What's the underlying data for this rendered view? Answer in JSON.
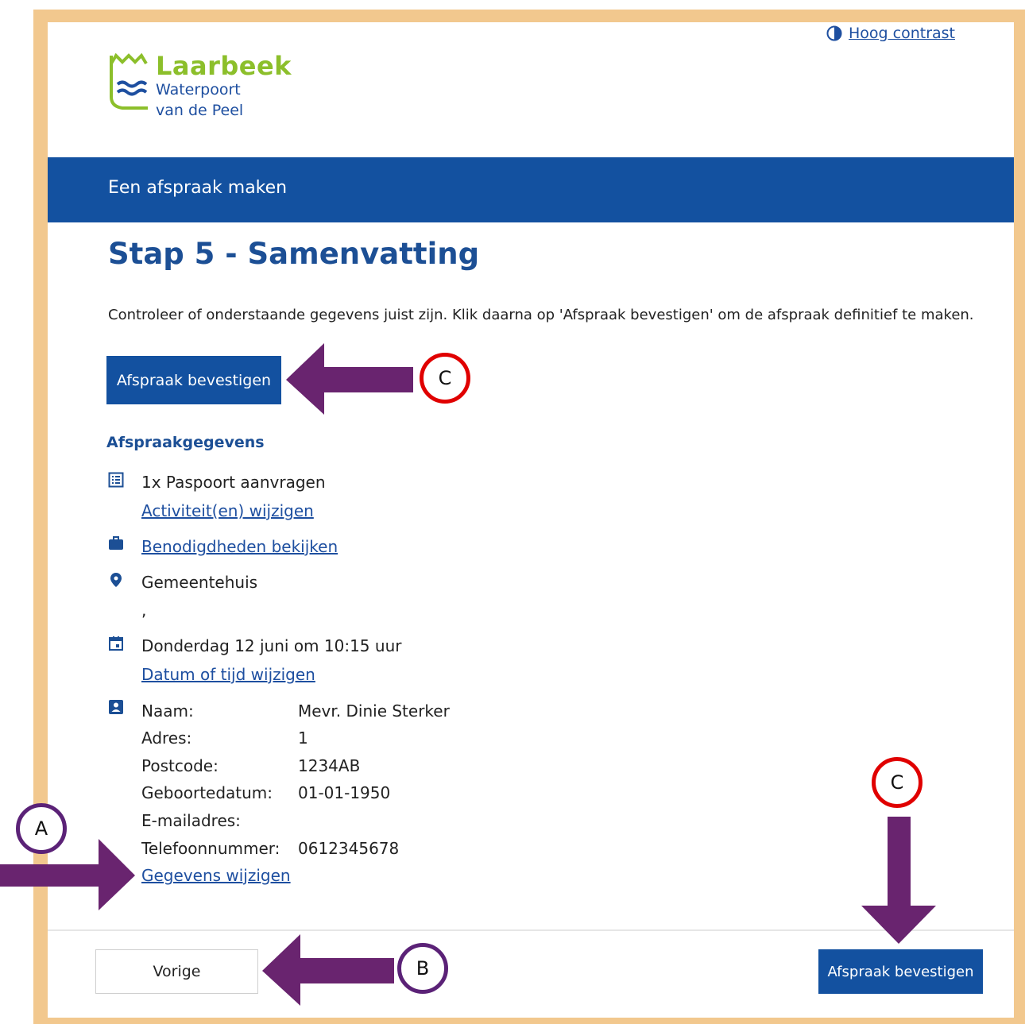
{
  "header": {
    "contrast_label": "Hoog contrast",
    "logo": {
      "name": "Laarbeek",
      "line2": "Waterpoort",
      "line3": "van de Peel"
    }
  },
  "banner": {
    "title": "Een afspraak maken"
  },
  "main": {
    "title": "Stap 5 - Samenvatting",
    "intro": "Controleer of onderstaande gegevens juist zijn. Klik daarna op 'Afspraak bevestigen' om de afspraak definitief te maken.",
    "confirm_label": "Afspraak bevestigen",
    "section_title": "Afspraakgegevens",
    "activity": "1x Paspoort aanvragen",
    "activity_link": "Activiteit(en) wijzigen",
    "requirements_link": "Benodigdheden bekijken",
    "location": "Gemeentehuis",
    "location_extra": ",",
    "datetime": "Donderdag 12 juni om 10:15 uur",
    "datetime_link": "Datum of tijd wijzigen",
    "personal": [
      {
        "label": "Naam:",
        "value": "Mevr. Dinie Sterker"
      },
      {
        "label": "Adres:",
        "value": "1"
      },
      {
        "label": "Postcode:",
        "value": "1234AB"
      },
      {
        "label": "Geboortedatum:",
        "value": "01-01-1950"
      },
      {
        "label": "E-mailadres:",
        "value": ""
      },
      {
        "label": "Telefoonnummer:",
        "value": "0612345678"
      }
    ],
    "personal_link": "Gegevens wijzigen"
  },
  "footer": {
    "prev_label": "Vorige",
    "confirm_label": "Afspraak bevestigen"
  },
  "annotations": {
    "markers": {
      "a": "A",
      "b": "B",
      "c_top": "C",
      "c_bottom": "C"
    },
    "colors": {
      "arrow": "#69246f",
      "red_ring": "#e00000",
      "purple_ring": "#5b2277"
    }
  },
  "colors": {
    "brand_blue": "#1351a0",
    "logo_green": "#8cbf2b",
    "frame": "#f2c88e"
  }
}
